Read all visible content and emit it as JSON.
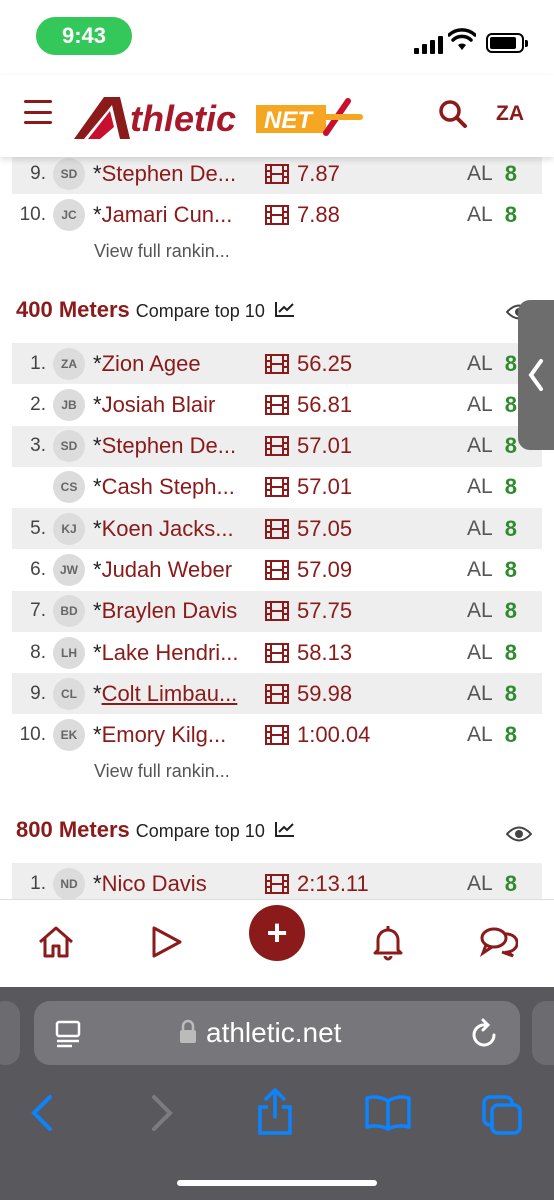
{
  "status": {
    "time": "9:43"
  },
  "header": {
    "logo_main": "thletic",
    "logo_net": "NET",
    "logo_a": "A",
    "profile": "ZA"
  },
  "sections": {
    "prev": {
      "rows": [
        {
          "rank": "9.",
          "initials": "SD",
          "name": "Stephen De...",
          "mark": "7.87",
          "state": "AL",
          "extra": "8"
        },
        {
          "rank": "10.",
          "initials": "JC",
          "name": "Jamari Cun...",
          "mark": "7.88",
          "state": "AL",
          "extra": "8"
        }
      ],
      "view_full": "View full rankin..."
    },
    "m400": {
      "title": "400 Meters",
      "compare": "Compare top 10",
      "rows": [
        {
          "rank": "1.",
          "initials": "ZA",
          "name": "Zion Agee",
          "mark": "56.25",
          "state": "AL",
          "extra": "8"
        },
        {
          "rank": "2.",
          "initials": "JB",
          "name": "Josiah Blair",
          "mark": "56.81",
          "state": "AL",
          "extra": "8"
        },
        {
          "rank": "3.",
          "initials": "SD",
          "name": "Stephen De...",
          "mark": "57.01",
          "state": "AL",
          "extra": "8"
        },
        {
          "rank": "",
          "initials": "CS",
          "name": "Cash Steph...",
          "mark": "57.01",
          "state": "AL",
          "extra": "8"
        },
        {
          "rank": "5.",
          "initials": "KJ",
          "name": "Koen Jacks...",
          "mark": "57.05",
          "state": "AL",
          "extra": "8"
        },
        {
          "rank": "6.",
          "initials": "JW",
          "name": "Judah Weber",
          "mark": "57.09",
          "state": "AL",
          "extra": "8"
        },
        {
          "rank": "7.",
          "initials": "BD",
          "name": "Braylen Davis",
          "mark": "57.75",
          "state": "AL",
          "extra": "8"
        },
        {
          "rank": "8.",
          "initials": "LH",
          "name": "Lake Hendri...",
          "mark": "58.13",
          "state": "AL",
          "extra": "8"
        },
        {
          "rank": "9.",
          "initials": "CL",
          "name": "Colt Limbau...",
          "mark": "59.98",
          "state": "AL",
          "extra": "8"
        },
        {
          "rank": "10.",
          "initials": "EK",
          "name": "Emory Kilg...",
          "mark": "1:00.04",
          "state": "AL",
          "extra": "8"
        }
      ],
      "view_full": "View full rankin..."
    },
    "m800": {
      "title": "800 Meters",
      "compare": "Compare top 10",
      "rows": [
        {
          "rank": "1.",
          "initials": "ND",
          "name": "Nico Davis",
          "mark": "2:13.11",
          "state": "AL",
          "extra": "8"
        }
      ]
    }
  },
  "star": "*",
  "safari": {
    "url": "athletic.net"
  },
  "colors": {
    "brand": "#8b1a1a",
    "green": "#2e8b2e",
    "status_pill": "#34c759"
  }
}
